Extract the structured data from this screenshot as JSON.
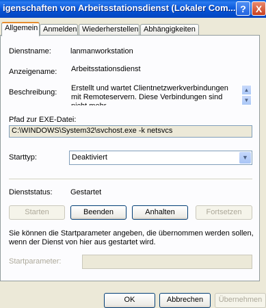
{
  "window": {
    "title": "igenschaften von Arbeitsstationsdienst (Lokaler Com...",
    "help_label": "?",
    "close_label": "X"
  },
  "tabs": [
    "Allgemein",
    "Anmelden",
    "Wiederherstellen",
    "Abhängigkeiten"
  ],
  "general": {
    "service_name_label": "Dienstname:",
    "service_name_value": "lanmanworkstation",
    "display_name_label": "Anzeigename:",
    "display_name_value": "Arbeitsstationsdienst",
    "description_label": "Beschreibung:",
    "description_value": "Erstellt und wartet Clientnetzwerkverbindungen mit Remoteservern. Diese Verbindungen sind nicht mehr",
    "exe_path_label": "Pfad zur EXE-Datei:",
    "exe_path_value": "C:\\WINDOWS\\System32\\svchost.exe -k netsvcs",
    "startup_type_label": "Starttyp:",
    "startup_type_value": "Deaktiviert",
    "status_label": "Dienststatus:",
    "status_value": "Gestartet",
    "buttons": {
      "start": "Starten",
      "stop": "Beenden",
      "pause": "Anhalten",
      "resume": "Fortsetzen"
    },
    "hint_line1": "Sie können die Startparameter angeben, die übernommen werden sollen,",
    "hint_line2": "wenn der Dienst von hier aus gestartet wird.",
    "start_params_label": "Startparameter:",
    "start_params_value": ""
  },
  "footer": {
    "ok": "OK",
    "cancel": "Abbrechen",
    "apply": "Übernehmen"
  }
}
